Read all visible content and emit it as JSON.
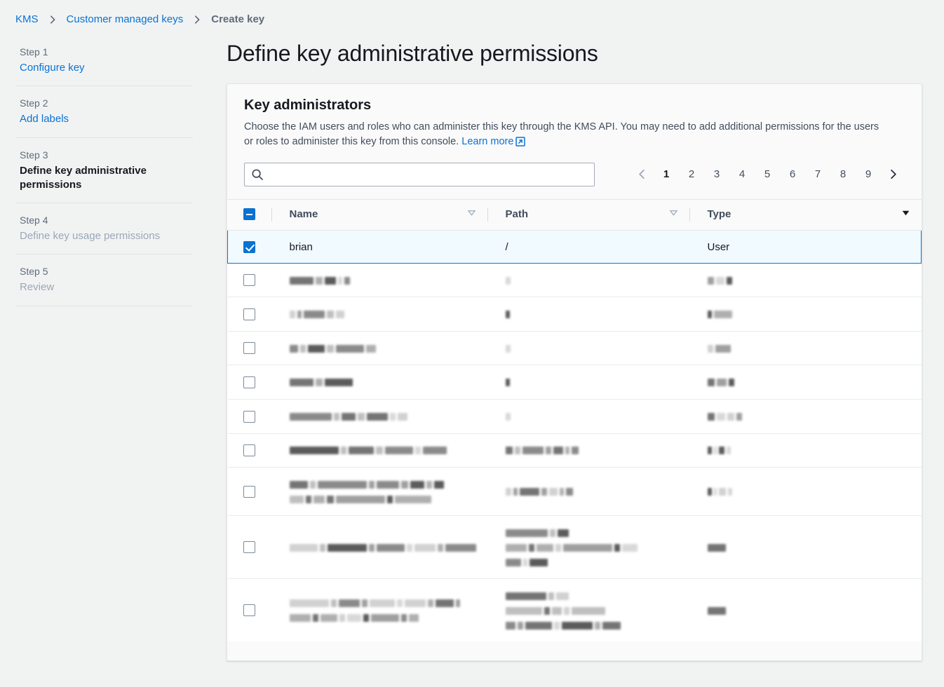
{
  "breadcrumb": {
    "items": [
      {
        "label": "KMS",
        "current": false
      },
      {
        "label": "Customer managed keys",
        "current": false
      },
      {
        "label": "Create key",
        "current": true
      }
    ]
  },
  "wizard": {
    "steps": [
      {
        "number": "Step 1",
        "label": "Configure key",
        "state": "link"
      },
      {
        "number": "Step 2",
        "label": "Add labels",
        "state": "link"
      },
      {
        "number": "Step 3",
        "label": "Define key administrative permissions",
        "state": "active"
      },
      {
        "number": "Step 4",
        "label": "Define key usage permissions",
        "state": "disabled"
      },
      {
        "number": "Step 5",
        "label": "Review",
        "state": "disabled"
      }
    ]
  },
  "page": {
    "title": "Define key administrative permissions"
  },
  "panel": {
    "title": "Key administrators",
    "description": "Choose the IAM users and roles who can administer this key through the KMS API. You may need to add additional permissions for the users or roles to administer this key from this console.",
    "learn_more_label": "Learn more"
  },
  "search": {
    "value": "",
    "placeholder": ""
  },
  "pagination": {
    "pages": [
      "1",
      "2",
      "3",
      "4",
      "5",
      "6",
      "7",
      "8",
      "9"
    ],
    "current": "1",
    "prev_enabled": false,
    "next_enabled": true
  },
  "table": {
    "select_all_state": "indeterminate",
    "columns": [
      {
        "label": "Name",
        "sort": "inactive"
      },
      {
        "label": "Path",
        "sort": "inactive"
      },
      {
        "label": "Type",
        "sort": "active-desc"
      }
    ],
    "rows": [
      {
        "selected": true,
        "redacted": false,
        "name": "brian",
        "path": "/",
        "type": "User"
      },
      {
        "selected": false,
        "redacted": true,
        "name_lines": [
          [
            34,
            10,
            16,
            6,
            8
          ]
        ],
        "path_lines": [
          [
            7
          ]
        ],
        "type_lines": [
          [
            9,
            12,
            8
          ]
        ]
      },
      {
        "selected": false,
        "redacted": true,
        "name_lines": [
          [
            8,
            6,
            30,
            10,
            12
          ]
        ],
        "path_lines": [
          [
            6
          ]
        ],
        "type_lines": [
          [
            6,
            26
          ]
        ]
      },
      {
        "selected": false,
        "redacted": true,
        "name_lines": [
          [
            12,
            8,
            24,
            10,
            40,
            14
          ]
        ],
        "path_lines": [
          [
            7
          ]
        ],
        "type_lines": [
          [
            8,
            22
          ]
        ]
      },
      {
        "selected": false,
        "redacted": true,
        "name_lines": [
          [
            34,
            10,
            40
          ]
        ],
        "path_lines": [
          [
            6
          ]
        ],
        "type_lines": [
          [
            10,
            14,
            8
          ]
        ]
      },
      {
        "selected": false,
        "redacted": true,
        "name_lines": [
          [
            60,
            8,
            20,
            10,
            30,
            8,
            14
          ]
        ],
        "path_lines": [
          [
            7
          ]
        ],
        "type_lines": [
          [
            10,
            12,
            10,
            8
          ]
        ]
      },
      {
        "selected": false,
        "redacted": true,
        "name_lines": [
          [
            70,
            8,
            36,
            10,
            40,
            8,
            34
          ]
        ],
        "path_lines": [
          [
            10,
            8,
            30,
            8,
            14,
            6,
            10
          ]
        ],
        "type_lines": [
          [
            6,
            4,
            8,
            6
          ]
        ]
      },
      {
        "selected": false,
        "redacted": true,
        "name_lines": [
          [
            26,
            8,
            70,
            8,
            32,
            10,
            20,
            8,
            14
          ],
          [
            20,
            8,
            16,
            10,
            70,
            8,
            52
          ]
        ],
        "path_lines": [
          [
            8,
            6,
            28,
            8,
            12,
            6,
            10
          ]
        ],
        "type_lines": [
          [
            6,
            4,
            10,
            6
          ]
        ]
      },
      {
        "selected": false,
        "redacted": true,
        "name_lines": [
          [
            40,
            8,
            56,
            8,
            40,
            8,
            30,
            8,
            44
          ]
        ],
        "path_lines": [
          [
            60,
            8,
            16
          ],
          [
            30,
            8,
            24,
            8,
            70,
            8,
            22
          ],
          [
            22,
            6,
            26
          ]
        ],
        "type_lines": [
          [
            26
          ]
        ]
      },
      {
        "selected": false,
        "redacted": true,
        "name_lines": [
          [
            56,
            8,
            30,
            8,
            36,
            8,
            30,
            8,
            26,
            6
          ],
          [
            30,
            8,
            24,
            8,
            20,
            8,
            40,
            8,
            14
          ]
        ],
        "path_lines": [
          [
            58,
            8,
            18
          ],
          [
            52,
            8,
            14,
            8,
            48
          ],
          [
            14,
            8,
            38,
            8,
            44,
            8,
            26
          ]
        ],
        "type_lines": [
          [
            26
          ]
        ]
      }
    ]
  },
  "colors": {
    "accent": "#0972d3",
    "selected_row_bg": "#f1faff",
    "page_bg": "#f1f3f3",
    "panel_bg": "#fafafa",
    "text": "#16191f",
    "muted_text": "#5f6b7a",
    "disabled_text": "#9ba7b6"
  },
  "icons": {
    "search": "search-icon",
    "external_link": "external-link-icon",
    "chevron_left": "chevron-left-icon",
    "chevron_right": "chevron-right-icon",
    "sort": "sort-triangle-icon"
  }
}
